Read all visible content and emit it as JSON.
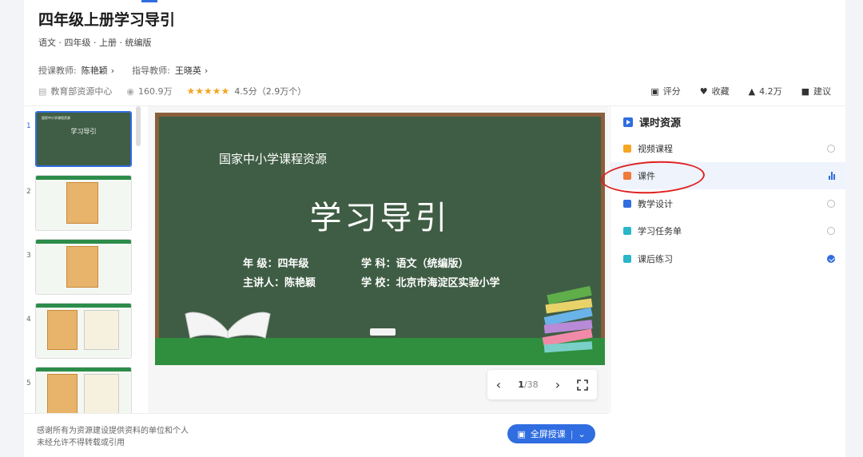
{
  "header": {
    "title": "四年级上册学习导引",
    "subtitle": "语文 · 四年级 · 上册 · 统编版",
    "teacher_label": "授课教师:",
    "teacher_name": "陈艳颖",
    "advisor_label": "指导教师:",
    "advisor_name": "王晓英"
  },
  "meta": {
    "source": "教育部资源中心",
    "views": "160.9万",
    "stars": "★★★★★",
    "rating": "4.5分（2.9万个）"
  },
  "actions": {
    "rate": "评分",
    "favorite": "收藏",
    "likes": "4.2万",
    "suggest": "建议"
  },
  "thumbs": {
    "numbers": [
      "1",
      "2",
      "3",
      "4",
      "5"
    ],
    "slide1_title": "学习导引",
    "slide1_org": "国家中小学课程资源"
  },
  "slide": {
    "org": "国家中小学课程资源",
    "title": "学习导引",
    "line1_left": "年  级：四年级",
    "line1_right": "学  科：语文（统编版）",
    "line2_left": "主讲人：陈艳颖",
    "line2_right": "学  校：北京市海淀区实验小学"
  },
  "pager": {
    "current": "1",
    "total": "/38"
  },
  "resources": {
    "heading": "课时资源",
    "items": [
      {
        "label": "视频课程",
        "color": "#f5a623"
      },
      {
        "label": "课件",
        "color": "#f07a3a"
      },
      {
        "label": "教学设计",
        "color": "#2f6de0"
      },
      {
        "label": "学习任务单",
        "color": "#29b6c8"
      },
      {
        "label": "课后练习",
        "color": "#29b6c8"
      }
    ]
  },
  "footer": {
    "line1": "感谢所有为资源建设提供资料的单位和个人",
    "line2": "未经允许不得转载或引用",
    "fullscreen": "全屏授课"
  }
}
